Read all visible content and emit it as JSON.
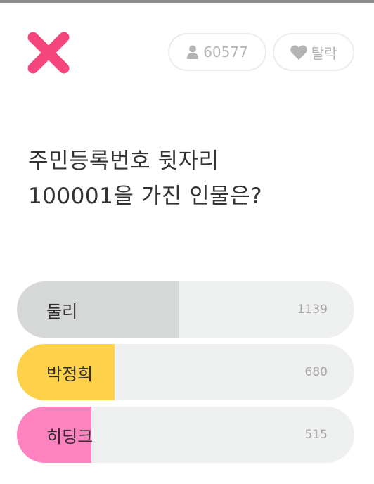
{
  "header": {
    "participant_count": "60577",
    "leave_label": "탈락",
    "icons": {
      "close": "close-icon",
      "participants": "person-icon",
      "leave": "heart-icon"
    },
    "colors": {
      "close": "#f4467c"
    }
  },
  "question": {
    "line1": "주민등록번호 뒷자리",
    "line2": "100001을 가진 인물은?"
  },
  "options": [
    {
      "label": "둘리",
      "votes": "1139",
      "share": 0.48,
      "color": "#d6d8d8"
    },
    {
      "label": "박정희",
      "votes": "680",
      "share": 0.29,
      "color": "#fdd14a"
    },
    {
      "label": "히딩크",
      "votes": "515",
      "share": 0.22,
      "color": "#ff83c0"
    }
  ]
}
